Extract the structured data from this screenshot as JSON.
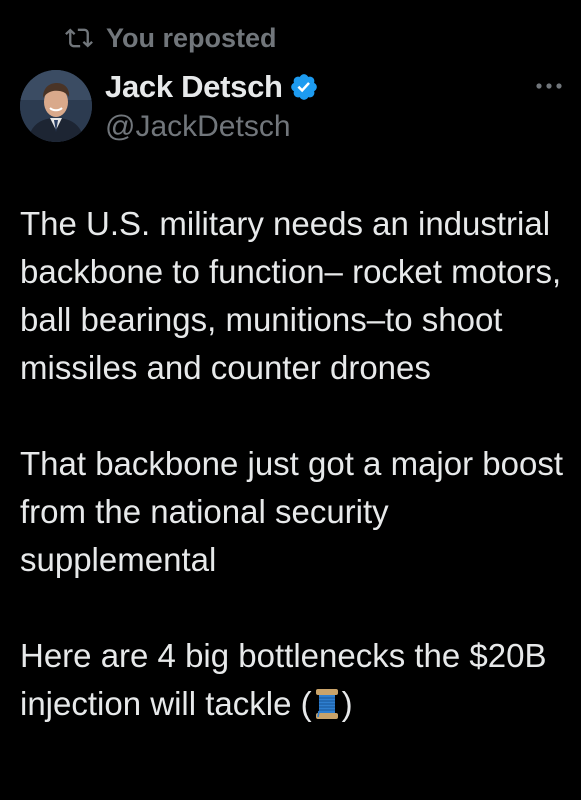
{
  "repost": {
    "label": "You reposted"
  },
  "author": {
    "name": "Jack Detsch",
    "handle": "@JackDetsch",
    "verified": true
  },
  "tweet": {
    "paragraph1": "The U.S. military needs an industrial backbone to function– rocket motors, ball bearings, munitions–to shoot missiles and counter drones",
    "paragraph2": "That backbone just got a major boost from the national security supplemental",
    "paragraph3_before_emoji": "Here are 4 big bottlenecks the $20B injection will tackle (",
    "paragraph3_after_emoji": ")",
    "emoji_name": "thread-spool-emoji"
  },
  "icons": {
    "repost": "repost-icon",
    "verified": "verified-badge-icon",
    "more": "more-options-icon"
  },
  "colors": {
    "background": "#000000",
    "text_primary": "#e7e9ea",
    "text_secondary": "#71767b",
    "verified_blue": "#1d9bf0"
  }
}
